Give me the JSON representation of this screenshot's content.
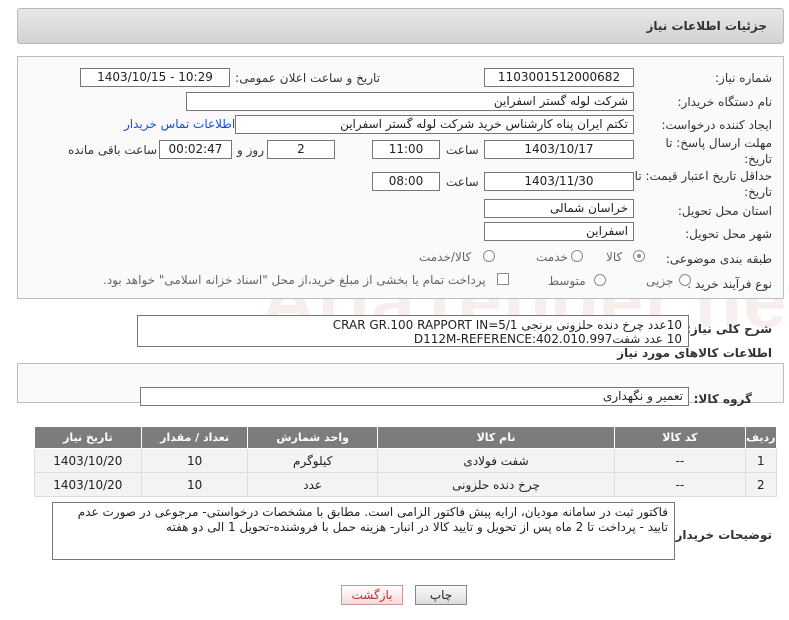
{
  "header": {
    "title": "جزئیات اطلاعات نیاز"
  },
  "watermark": "AriaTender.net",
  "form": {
    "need_number": {
      "label": "شماره نیاز:",
      "value": "1103001512000682"
    },
    "announce_datetime": {
      "label": "تاریخ و ساعت اعلان عمومی:",
      "value": "1403/10/15 - 10:29"
    },
    "buyer_org": {
      "label": "نام دستگاه خریدار:",
      "value": "شرکت لوله گستر اسفراین"
    },
    "requester": {
      "label": "ایجاد کننده درخواست:",
      "value": "تکتم ایران پناه کارشناس خرید شرکت لوله گستر اسفراین",
      "contact_link": "اطلاعات تماس خریدار"
    },
    "reply_deadline": {
      "label": "مهلت ارسال پاسخ: تا تاریخ:",
      "date": "1403/10/17",
      "time_label": "ساعت",
      "time": "11:00",
      "days": "2",
      "days_label": "روز و",
      "remaining": "00:02:47",
      "remaining_label": "ساعت باقی مانده"
    },
    "price_validity": {
      "label": "حداقل تاریخ اعتبار قیمت: تا تاریخ:",
      "date": "1403/11/30",
      "time_label": "ساعت",
      "time": "08:00"
    },
    "province": {
      "label": "استان محل تحویل:",
      "value": "خراسان شمالی"
    },
    "city": {
      "label": "شهر محل تحویل:",
      "value": "اسفراین"
    },
    "category": {
      "label": "طبقه بندی موضوعی:",
      "options": [
        "کالا",
        "خدمت",
        "کالا/خدمت"
      ],
      "selected": "کالا"
    },
    "purchase_type": {
      "label": "نوع فرآیند خرید :",
      "options": [
        "جزیی",
        "متوسط"
      ],
      "note": "پرداخت تمام یا بخشی از مبلغ خرید،از محل \"اسناد خزانه اسلامی\" خواهد بود."
    }
  },
  "description": {
    "label": "شرح کلی نیاز:",
    "line1": "10عدد چرخ دنده حلزونی برنجی CRAR GR.100 RAPPORT IN=5/1",
    "line2": "10 عدد شفتD112M-REFERENCE:402.010.997"
  },
  "goods": {
    "title": "اطلاعات کالاهای مورد نیاز",
    "group_label": "گروه کالا:",
    "group_value": "تعمیر و نگهداری",
    "columns": [
      "ردیف",
      "کد کالا",
      "نام کالا",
      "واحد شمارش",
      "تعداد / مقدار",
      "تاریخ نیاز"
    ],
    "rows": [
      {
        "idx": "1",
        "code": "--",
        "name": "شفت فولادی",
        "unit": "کیلوگرم",
        "qty": "10",
        "date": "1403/10/20"
      },
      {
        "idx": "2",
        "code": "--",
        "name": "چرخ دنده حلزونی",
        "unit": "عدد",
        "qty": "10",
        "date": "1403/10/20"
      }
    ]
  },
  "buyer_notes": {
    "label": "توضیحات خریدار:",
    "text": "فاکتور ثبت در سامانه مودیان، ارایه پیش فاکتور الزامی است. مطابق با مشخصات درخواستی- مرجوعی در صورت عدم تایید - پرداخت تا 2 ماه پس از تحویل و تایید کالا در انبار- هزینه حمل با فروشنده-تحویل 1 الی دو هفته"
  },
  "buttons": {
    "print": "چاپ",
    "back": "بازگشت"
  }
}
